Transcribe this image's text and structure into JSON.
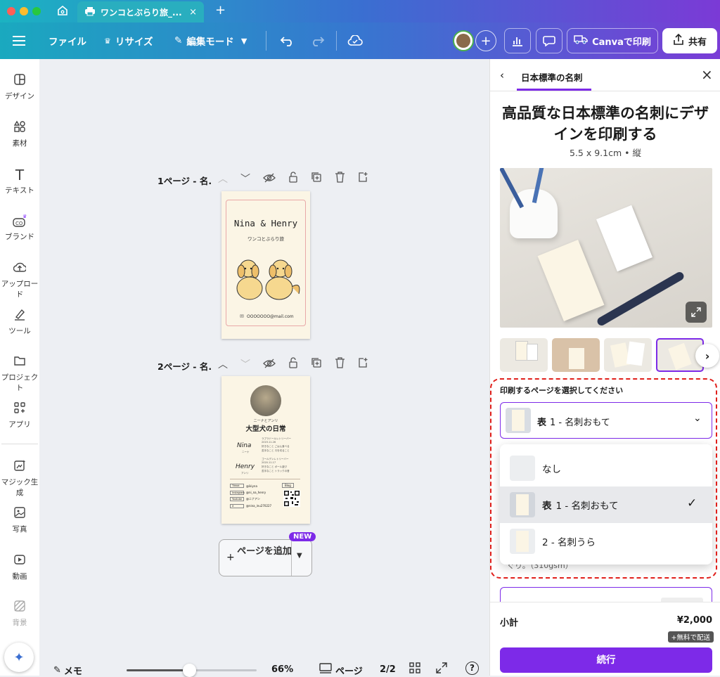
{
  "browser": {
    "tab_title": "ワンコとぶらり旅_...",
    "tab_close": "×",
    "new_tab": "+"
  },
  "toolbar": {
    "file": "ファイル",
    "resize": "リサイズ",
    "edit_mode": "編集モード",
    "print": "Canvaで印刷",
    "share": "共有"
  },
  "sidebar": {
    "items": [
      {
        "label": "デザイン",
        "icon": "design-icon"
      },
      {
        "label": "素材",
        "icon": "elements-icon"
      },
      {
        "label": "テキスト",
        "icon": "text-icon"
      },
      {
        "label": "ブランド",
        "icon": "brand-icon"
      },
      {
        "label": "アップロード",
        "icon": "upload-icon"
      },
      {
        "label": "ツール",
        "icon": "tools-icon"
      },
      {
        "label": "プロジェクト",
        "icon": "folder-icon"
      },
      {
        "label": "アプリ",
        "icon": "apps-icon"
      },
      {
        "label": "マジック生成",
        "icon": "magic-icon"
      },
      {
        "label": "写真",
        "icon": "photo-icon"
      },
      {
        "label": "動画",
        "icon": "video-icon"
      },
      {
        "label": "背景",
        "icon": "background-icon"
      }
    ]
  },
  "pages": [
    {
      "label": "1ページ - 名.",
      "card_title": "Nina & Henry",
      "card_subtitle": "ワンコとぶらり旅",
      "card_email": "OOOOOOO@mail.com"
    },
    {
      "label": "2ページ - 名.",
      "card_kicker": "ニーナとアンリ",
      "card_title": "大型犬の日常",
      "name1": "Nina",
      "name1_jp": "ニーナ",
      "name2": "Henry",
      "name2_jp": "アンリ",
      "breed1": "ラブラドールレトリーバー",
      "breed2": "ゴールデンレトリーバー",
      "date1": "2019.11.26",
      "date2": "2020.11.17",
      "like1": "好きなこと ごはん食べる",
      "dislike1": "苦手なこと 爪を切ること",
      "like2": "好きなこと ボール遊び",
      "dislike2": "苦手なこと トラックの音",
      "sns": [
        {
          "platform": "Tiktok",
          "handle": "@ikiyna"
        },
        {
          "platform": "Instagram",
          "handle": "@ni_na_henry"
        },
        {
          "platform": "Youtube",
          "handle": "@ニナアン"
        },
        {
          "platform": "X",
          "handle": "@nina_inu270227"
        }
      ],
      "blog": "Blog"
    }
  ],
  "add_page": {
    "label": "ページを追加",
    "badge": "NEW"
  },
  "footer": {
    "notes": "メモ",
    "zoom": "66%",
    "pages": "ページ",
    "page_count": "2/2"
  },
  "panel": {
    "breadcrumb": "日本標準の名刺",
    "heading": "高品質な日本標準の名刺にデザインを印刷する",
    "size": "5.5 x 9.1cm • 縦",
    "select_label": "印刷するページを選択してください",
    "selected_front": "表",
    "selected_value": "1 - 名刺おもて",
    "options": [
      {
        "front": "",
        "label": "なし"
      },
      {
        "front": "表",
        "label": "1 - 名刺おもて",
        "checked": true
      },
      {
        "front": "",
        "label": "2 - 名刺うら"
      }
    ],
    "paper_hint": "ぐり。（310gsm）",
    "subtotal_label": "小計",
    "subtotal_value": "¥2,000",
    "shipping_badge": "+無料で配送",
    "continue_label": "続行"
  }
}
